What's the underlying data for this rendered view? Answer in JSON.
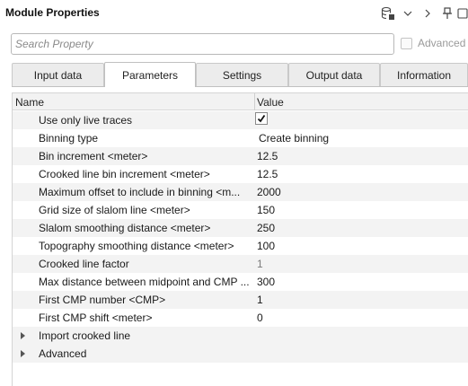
{
  "panel": {
    "title": "Module Properties"
  },
  "search": {
    "placeholder": "Search Property",
    "value": ""
  },
  "advanced_toggle": {
    "label": "Advanced",
    "checked": false
  },
  "tabs": [
    {
      "label": "Input data",
      "active": false
    },
    {
      "label": "Parameters",
      "active": true
    },
    {
      "label": "Settings",
      "active": false
    },
    {
      "label": "Output data",
      "active": false
    },
    {
      "label": "Information",
      "active": false
    }
  ],
  "grid": {
    "headers": {
      "name": "Name",
      "value": "Value"
    },
    "rows": [
      {
        "name": "Use only live traces",
        "value": "",
        "type": "checkbox",
        "checked": true
      },
      {
        "name": "Binning type",
        "value": "Create binning",
        "type": "dropdown"
      },
      {
        "name": "Bin increment <meter>",
        "value": "12.5",
        "type": "text"
      },
      {
        "name": "Crooked line bin increment <meter>",
        "value": "12.5",
        "type": "text"
      },
      {
        "name": "Maximum offset to include in binning <m...",
        "value": "2000",
        "type": "text"
      },
      {
        "name": "Grid size of slalom line <meter>",
        "value": "150",
        "type": "text"
      },
      {
        "name": "Slalom smoothing distance <meter>",
        "value": "250",
        "type": "text"
      },
      {
        "name": "Topography smoothing distance <meter>",
        "value": "100",
        "type": "text"
      },
      {
        "name": "Crooked line factor",
        "value": "1",
        "type": "readonly"
      },
      {
        "name": "Max distance between midpoint and CMP ...",
        "value": "300",
        "type": "text"
      },
      {
        "name": "First CMP number <CMP>",
        "value": "1",
        "type": "text"
      },
      {
        "name": "First CMP shift <meter>",
        "value": "0",
        "type": "text"
      }
    ],
    "groups": [
      {
        "name": "Import crooked line",
        "expanded": false
      },
      {
        "name": "Advanced",
        "expanded": false
      }
    ]
  },
  "colors": {
    "tab_inactive": "#ececec",
    "row_alt": "#f3f3f3",
    "border": "#c9c9c9"
  }
}
